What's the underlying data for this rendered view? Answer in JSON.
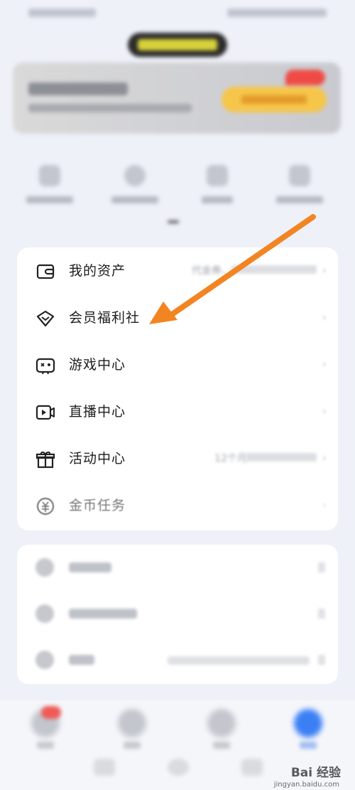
{
  "menu": {
    "items": [
      {
        "label": "我的资产",
        "sub": "代金券、",
        "icon": "wallet-icon"
      },
      {
        "label": "会员福利社",
        "sub": "",
        "icon": "diamond-icon"
      },
      {
        "label": "游戏中心",
        "sub": "",
        "icon": "game-icon"
      },
      {
        "label": "直播中心",
        "sub": "",
        "icon": "live-icon"
      },
      {
        "label": "活动中心",
        "sub": "12个月",
        "icon": "gift-icon"
      },
      {
        "label": "金币任务",
        "sub": "",
        "icon": "coin-icon"
      }
    ]
  },
  "watermark": {
    "brand": "Bai 经验",
    "url": "jingyan.baidu.com"
  },
  "colors": {
    "arrow": "#f28522",
    "tab_active": "#3b7ff5",
    "badge": "#ef5a55"
  }
}
